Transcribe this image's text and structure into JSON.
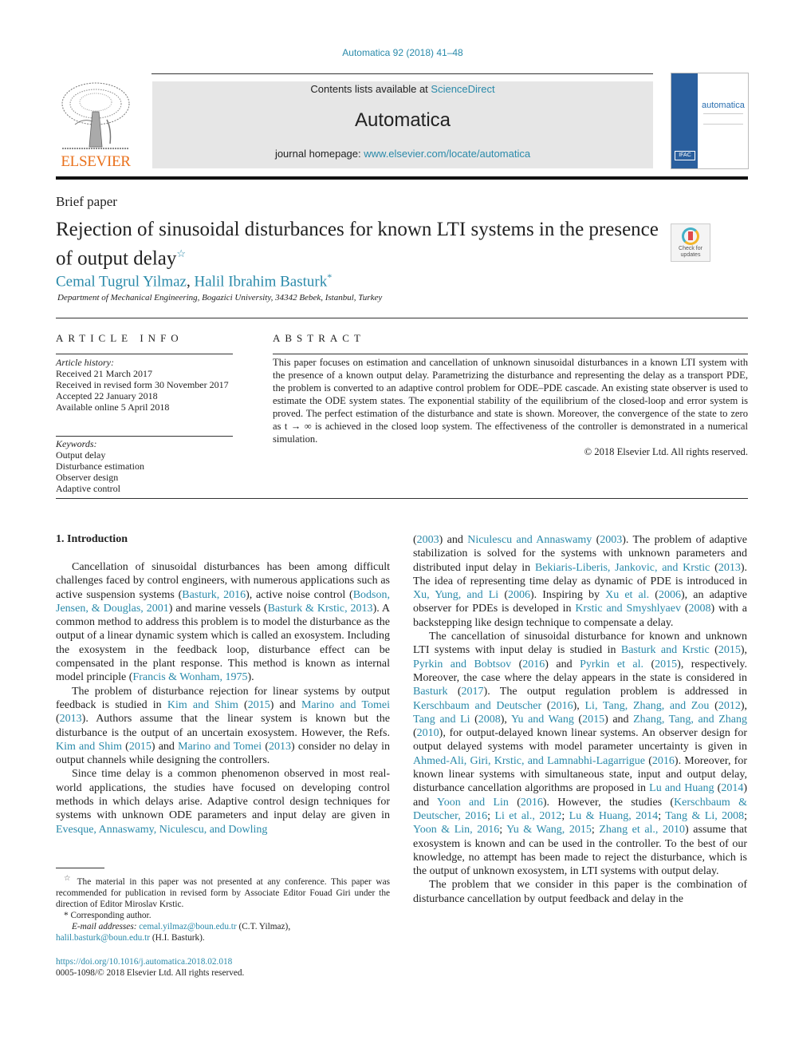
{
  "header": {
    "journal_ref": "Automatica 92 (2018) 41–48",
    "contents_prefix": "Contents lists available at ",
    "contents_link": "ScienceDirect",
    "journal_title": "Automatica",
    "homepage_prefix": "journal homepage: ",
    "homepage_link": "www.elsevier.com/locate/automatica",
    "publisher_logo_text": "ELSEVIER",
    "cover_title": "automatica",
    "cover_badge": "IFAC",
    "crossmark_text": "Check for updates",
    "colors": {
      "link": "#2a8aaa",
      "elsevier_orange": "#e9711c",
      "cover_blue": "#2a5f9e",
      "banner_gray": "#e6e6e6"
    }
  },
  "article": {
    "type": "Brief paper",
    "title": "Rejection of sinusoidal disturbances for known LTI systems in the presence of output delay",
    "title_note_mark": "☆",
    "authors": [
      {
        "name": "Cemal Tugrul Yilmaz",
        "mark": ""
      },
      {
        "name": "Halil Ibrahim Basturk",
        "mark": "*"
      }
    ],
    "author_separator": ", ",
    "affiliation": "Department of Mechanical Engineering, Bogazici University, 34342 Bebek, Istanbul, Turkey"
  },
  "article_info": {
    "heading": "ARTICLE INFO",
    "history_label": "Article history:",
    "history": [
      "Received 21 March 2017",
      "Received in revised form 30 November 2017",
      "Accepted 22 January 2018",
      "Available online 5 April 2018"
    ],
    "keywords_label": "Keywords:",
    "keywords": [
      "Output delay",
      "Disturbance estimation",
      "Observer design",
      "Adaptive control"
    ]
  },
  "abstract": {
    "heading": "ABSTRACT",
    "text": "This paper focuses on estimation and cancellation of unknown sinusoidal disturbances in a known LTI system with the presence of a known output delay. Parametrizing the disturbance and representing the delay as a transport PDE, the problem is converted to an adaptive control problem for ODE–PDE cascade. An existing state observer is used to estimate the ODE system states. The exponential stability of the equilibrium of the closed-loop and error system is proved. The perfect estimation of the disturbance and state is shown. Moreover, the convergence of the state to zero as t → ∞ is achieved in the closed loop system. The effectiveness of the controller is demonstrated in a numerical simulation.",
    "copyright": "© 2018 Elsevier Ltd. All rights reserved."
  },
  "intro": {
    "heading": "1.  Introduction",
    "paragraphs": [
      [
        {
          "t": "Cancellation of sinusoidal disturbances has been among difficult challenges faced by control engineers, with numerous applications such as active suspension systems ("
        },
        {
          "t": "Basturk, 2016",
          "link": true
        },
        {
          "t": "), active noise control ("
        },
        {
          "t": "Bodson, Jensen, & Douglas, 2001",
          "link": true
        },
        {
          "t": ") and marine vessels ("
        },
        {
          "t": "Basturk & Krstic, 2013",
          "link": true
        },
        {
          "t": "). A common method to address this problem is to model the disturbance as the output of a linear dynamic system which is called an exosystem. Including the exosystem in the feedback loop, disturbance effect can be compensated in the plant response. This method is known as internal model principle ("
        },
        {
          "t": "Francis & Wonham, 1975",
          "link": true
        },
        {
          "t": ")."
        }
      ],
      [
        {
          "t": "The problem of disturbance rejection for linear systems by output feedback is studied in "
        },
        {
          "t": "Kim and Shim",
          "link": true
        },
        {
          "t": " ("
        },
        {
          "t": "2015",
          "link": true
        },
        {
          "t": ") and "
        },
        {
          "t": "Marino and Tomei",
          "link": true
        },
        {
          "t": " ("
        },
        {
          "t": "2013",
          "link": true
        },
        {
          "t": "). Authors assume that the linear system is known but the disturbance is the output of an uncertain exosystem. However, the Refs. "
        },
        {
          "t": "Kim and Shim",
          "link": true
        },
        {
          "t": " ("
        },
        {
          "t": "2015",
          "link": true
        },
        {
          "t": ") and "
        },
        {
          "t": "Marino and Tomei",
          "link": true
        },
        {
          "t": " ("
        },
        {
          "t": "2013",
          "link": true
        },
        {
          "t": ") consider no delay in output channels while designing the controllers."
        }
      ],
      [
        {
          "t": "Since time delay is a common phenomenon observed in most real-world applications, the studies have focused on developing control methods in which delays arise. Adaptive control design techniques for systems with unknown ODE parameters and input delay are given in "
        },
        {
          "t": "Evesque, Annaswamy, Niculescu, and Dowling",
          "link": true
        }
      ]
    ],
    "right_paragraphs": [
      [
        {
          "t": "("
        },
        {
          "t": "2003",
          "link": true
        },
        {
          "t": ") and "
        },
        {
          "t": "Niculescu and Annaswamy",
          "link": true
        },
        {
          "t": " ("
        },
        {
          "t": "2003",
          "link": true
        },
        {
          "t": "). The problem of adaptive stabilization is solved for the systems with unknown parameters and distributed input delay in "
        },
        {
          "t": "Bekiaris-Liberis, Jankovic, and Krstic",
          "link": true
        },
        {
          "t": " ("
        },
        {
          "t": "2013",
          "link": true
        },
        {
          "t": "). The idea of representing time delay as dynamic of PDE is introduced in "
        },
        {
          "t": "Xu, Yung, and Li",
          "link": true
        },
        {
          "t": " ("
        },
        {
          "t": "2006",
          "link": true
        },
        {
          "t": "). Inspiring by "
        },
        {
          "t": "Xu et al.",
          "link": true
        },
        {
          "t": " ("
        },
        {
          "t": "2006",
          "link": true
        },
        {
          "t": "), an adaptive observer for PDEs is developed in "
        },
        {
          "t": "Krstic and Smyshlyaev",
          "link": true
        },
        {
          "t": " ("
        },
        {
          "t": "2008",
          "link": true
        },
        {
          "t": ") with a backstepping like design technique to compensate a delay."
        }
      ],
      [
        {
          "t": "The cancellation of sinusoidal disturbance for known and unknown LTI systems with input delay is studied in "
        },
        {
          "t": "Basturk and Krstic",
          "link": true
        },
        {
          "t": " ("
        },
        {
          "t": "2015",
          "link": true
        },
        {
          "t": "), "
        },
        {
          "t": "Pyrkin and Bobtsov",
          "link": true
        },
        {
          "t": " ("
        },
        {
          "t": "2016",
          "link": true
        },
        {
          "t": ") and "
        },
        {
          "t": "Pyrkin et al.",
          "link": true
        },
        {
          "t": " ("
        },
        {
          "t": "2015",
          "link": true
        },
        {
          "t": "), respectively. Moreover, the case where the delay appears in the state is considered in "
        },
        {
          "t": "Basturk",
          "link": true
        },
        {
          "t": " ("
        },
        {
          "t": "2017",
          "link": true
        },
        {
          "t": "). The output regulation problem is addressed in "
        },
        {
          "t": "Kerschbaum and Deutscher",
          "link": true
        },
        {
          "t": " ("
        },
        {
          "t": "2016",
          "link": true
        },
        {
          "t": "), "
        },
        {
          "t": "Li, Tang, Zhang, and Zou",
          "link": true
        },
        {
          "t": " ("
        },
        {
          "t": "2012",
          "link": true
        },
        {
          "t": "), "
        },
        {
          "t": "Tang and Li",
          "link": true
        },
        {
          "t": " ("
        },
        {
          "t": "2008",
          "link": true
        },
        {
          "t": "), "
        },
        {
          "t": "Yu and Wang",
          "link": true
        },
        {
          "t": " ("
        },
        {
          "t": "2015",
          "link": true
        },
        {
          "t": ") and "
        },
        {
          "t": "Zhang, Tang, and Zhang",
          "link": true
        },
        {
          "t": " ("
        },
        {
          "t": "2010",
          "link": true
        },
        {
          "t": "), for output-delayed known linear systems. An observer design for output delayed systems with model parameter uncertainty is given in "
        },
        {
          "t": "Ahmed-Ali, Giri, Krstic, and Lamnabhi-Lagarrigue",
          "link": true
        },
        {
          "t": " ("
        },
        {
          "t": "2016",
          "link": true
        },
        {
          "t": "). Moreover, for known linear systems with simultaneous state, input and output delay, disturbance cancellation algorithms are proposed in "
        },
        {
          "t": "Lu and Huang",
          "link": true
        },
        {
          "t": " ("
        },
        {
          "t": "2014",
          "link": true
        },
        {
          "t": ") and "
        },
        {
          "t": "Yoon and Lin",
          "link": true
        },
        {
          "t": " ("
        },
        {
          "t": "2016",
          "link": true
        },
        {
          "t": "). However, the studies ("
        },
        {
          "t": "Kerschbaum & Deutscher, 2016",
          "link": true
        },
        {
          "t": "; "
        },
        {
          "t": "Li et al., 2012",
          "link": true
        },
        {
          "t": "; "
        },
        {
          "t": "Lu & Huang, 2014",
          "link": true
        },
        {
          "t": "; "
        },
        {
          "t": "Tang & Li, 2008",
          "link": true
        },
        {
          "t": "; "
        },
        {
          "t": "Yoon & Lin, 2016",
          "link": true
        },
        {
          "t": "; "
        },
        {
          "t": "Yu & Wang, 2015",
          "link": true
        },
        {
          "t": "; "
        },
        {
          "t": "Zhang et al., 2010",
          "link": true
        },
        {
          "t": ") assume that exosystem is known and can be used in the controller. To the best of our knowledge, no attempt has been made to reject the disturbance, which is the output of unknown exosystem, in LTI systems with output delay."
        }
      ],
      [
        {
          "t": "The problem that we consider in this paper is the combination of disturbance cancellation by output feedback and delay in the"
        }
      ]
    ]
  },
  "footnotes": {
    "star_mark": "☆",
    "star_text": " The material in this paper was not presented at any conference. This paper was recommended for publication in revised form by Associate Editor Fouad Giri under the direction of Editor Miroslav Krstic.",
    "corr_mark": "*",
    "corr_text": " Corresponding author.",
    "email_label": "E-mail addresses: ",
    "email1": "cemal.yilmaz@boun.edu.tr",
    "email1_owner": " (C.T. Yilmaz),",
    "email2": "halil.basturk@boun.edu.tr",
    "email2_owner": " (H.I. Basturk).",
    "doi": "https://doi.org/10.1016/j.automatica.2018.02.018",
    "issn_copyright": "0005-1098/© 2018 Elsevier Ltd. All rights reserved."
  }
}
